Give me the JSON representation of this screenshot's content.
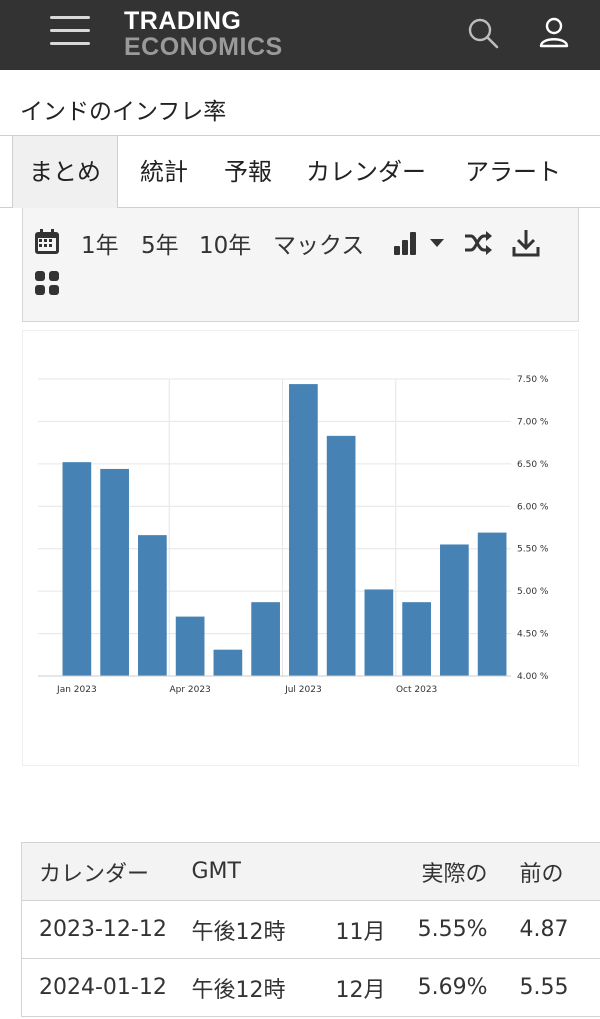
{
  "header": {
    "logo_line1": "TRADING",
    "logo_line2": "ECONOMICS",
    "icons": {
      "menu": "hamburger-menu-icon",
      "search": "search-icon",
      "user": "user-icon"
    }
  },
  "page": {
    "title": "インドのインフレ率"
  },
  "tabs": [
    {
      "label": "まとめ",
      "active": true
    },
    {
      "label": "統計"
    },
    {
      "label": "予報"
    },
    {
      "label": "カレンダー"
    },
    {
      "label": "アラート"
    }
  ],
  "toolbar": {
    "ranges": [
      "1年",
      "5年",
      "10年",
      "マックス"
    ],
    "icons": [
      "calendar-icon",
      "bar-chart-icon",
      "dropdown-caret-icon",
      "shuffle-icon",
      "download-icon",
      "grid-icon"
    ]
  },
  "chart_data": {
    "type": "bar",
    "categories": [
      "Jan 2023",
      "Feb 2023",
      "Mar 2023",
      "Apr 2023",
      "May 2023",
      "Jun 2023",
      "Jul 2023",
      "Aug 2023",
      "Sep 2023",
      "Oct 2023",
      "Nov 2023",
      "Dec 2023"
    ],
    "values": [
      6.52,
      6.44,
      5.66,
      4.7,
      4.31,
      4.87,
      7.44,
      6.83,
      5.02,
      4.87,
      5.55,
      5.69
    ],
    "x_tick_labels": [
      "Jan 2023",
      "Apr 2023",
      "Jul 2023",
      "Oct 2023"
    ],
    "x_tick_indices": [
      0,
      3,
      6,
      9
    ],
    "y_tick_labels": [
      "7.50 %",
      "7.00 %",
      "6.50 %",
      "6.00 %",
      "5.50 %",
      "5.00 %",
      "4.50 %",
      "4.00 %"
    ],
    "ylim": [
      4.0,
      7.5
    ],
    "y_axis_side": "right",
    "grid": true,
    "bar_color": "#4682b4",
    "title": "",
    "xlabel": "",
    "ylabel": ""
  },
  "calendar_table": {
    "headers": [
      "カレンダー",
      "GMT",
      "",
      "実際の",
      "前の"
    ],
    "rows": [
      [
        "2023-12-12",
        "午後12時",
        "11月",
        "5.55%",
        "4.87"
      ],
      [
        "2024-01-12",
        "午後12時",
        "12月",
        "5.69%",
        "5.55"
      ]
    ]
  }
}
